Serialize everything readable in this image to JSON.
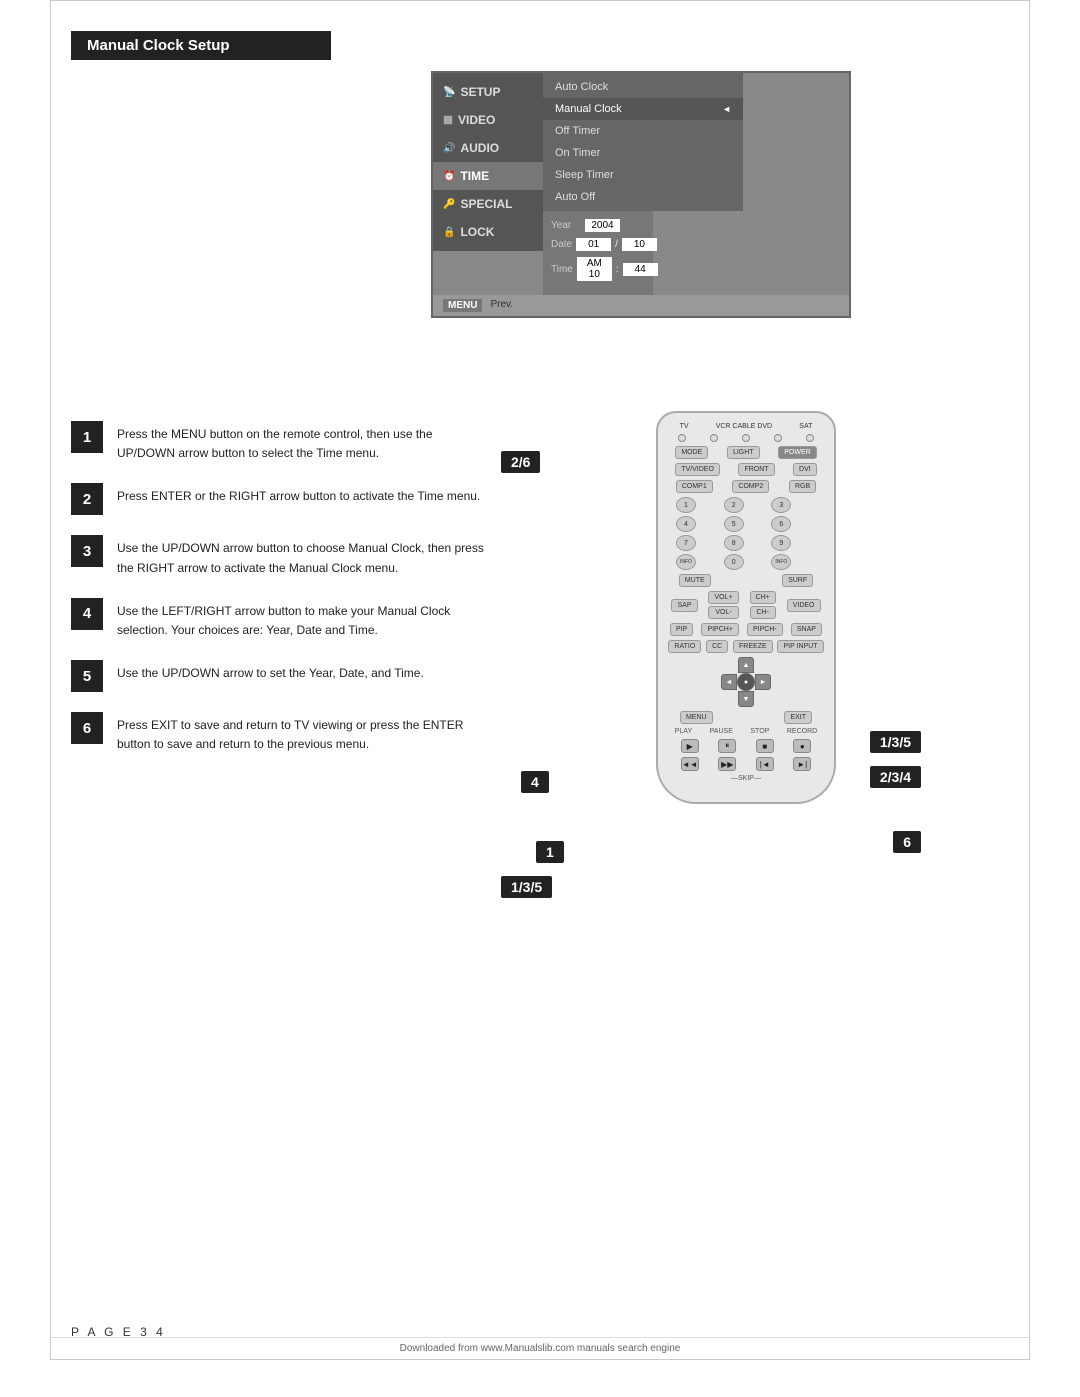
{
  "page": {
    "title": "Manual Clock Setup",
    "page_number": "P A G E  3 4",
    "footer": "Downloaded from www.Manualslib.com manuals search engine"
  },
  "tv_menu": {
    "items": [
      {
        "id": "setup",
        "label": "SETUP",
        "icon": "antenna"
      },
      {
        "id": "video",
        "label": "VIDEO",
        "icon": "square"
      },
      {
        "id": "audio",
        "label": "AUDIO",
        "icon": "speaker"
      },
      {
        "id": "time",
        "label": "TIME",
        "icon": "clock",
        "active": true
      },
      {
        "id": "special",
        "label": "SPECIAL",
        "icon": "key"
      },
      {
        "id": "lock",
        "label": "LOCK",
        "icon": "lock"
      }
    ],
    "submenu": [
      {
        "label": "Auto Clock",
        "active": false
      },
      {
        "label": "Manual Clock",
        "active": true,
        "marker": "◄"
      },
      {
        "label": "Off Timer",
        "active": false
      },
      {
        "label": "On Timer",
        "active": false
      },
      {
        "label": "Sleep Timer",
        "active": false
      },
      {
        "label": "Auto Off",
        "active": false
      }
    ],
    "settings": {
      "year_label": "Year",
      "year_value": "2004",
      "date_label": "Date",
      "date_value1": "01",
      "date_sep": "/",
      "date_value2": "10",
      "time_label": "Time",
      "time_am_pm": "AM 10",
      "time_sep": ":",
      "time_min": "44"
    },
    "footer": {
      "menu_label": "MENU",
      "prev_label": "Prev."
    }
  },
  "steps": [
    {
      "number": "1",
      "text": "Press the MENU button on the remote control, then use the UP/DOWN arrow button to select the Time menu."
    },
    {
      "number": "2",
      "text": "Press ENTER or the RIGHT arrow button to activate the Time menu."
    },
    {
      "number": "3",
      "text": "Use the UP/DOWN arrow button to choose Manual Clock, then press the RIGHT arrow to activate the Manual Clock menu."
    },
    {
      "number": "4",
      "text": "Use the LEFT/RIGHT arrow button to make your Manual Clock selection. Your choices are: Year, Date and Time."
    },
    {
      "number": "5",
      "text": "Use the UP/DOWN arrow to set the Year, Date, and Time."
    },
    {
      "number": "6",
      "text": "Press EXIT to save and return to TV viewing or press the ENTER button to save and return to the previous menu."
    }
  ],
  "callouts": {
    "badge_2_6": "2/6",
    "badge_4": "4",
    "badge_1": "1",
    "badge_1_3_5": "1/3/5",
    "badge_1_3_5_right": "1/3/5",
    "badge_2_3_4": "2/3/4",
    "badge_6_right": "6"
  },
  "remote": {
    "top_labels": [
      "TV",
      "VCR",
      "CABLE",
      "DVD",
      "SAT"
    ],
    "row1": [
      "MODE",
      "LIGHT",
      "POWER"
    ],
    "row2": [
      "TV/VIDEO",
      "FRONT",
      "DVI"
    ],
    "row3": [
      "COMP1",
      "COMP2",
      "RGB"
    ],
    "numbers": [
      "1",
      "2",
      "3",
      "4",
      "5",
      "6",
      "7",
      "8",
      "9",
      "",
      "0",
      "INFO"
    ],
    "special_row": [
      "MUTE",
      "",
      "SURF"
    ],
    "vol_ch": [
      "SAP",
      "VOL",
      "CH",
      "VIDEO"
    ],
    "pip_row": [
      "PIP",
      "PIPCH+",
      "PIPCH-",
      "SNAP"
    ],
    "func_row": [
      "RATIO",
      "CC",
      "FREEZE",
      "PIP INPUT"
    ],
    "nav_center": "●",
    "menu_exit": [
      "MENU",
      "EXIT"
    ],
    "playback": [
      "PLAY",
      "PAUSE",
      "STOP",
      "RECORD",
      "REW",
      "FF",
      "◄◄",
      "SKIP"
    ]
  }
}
